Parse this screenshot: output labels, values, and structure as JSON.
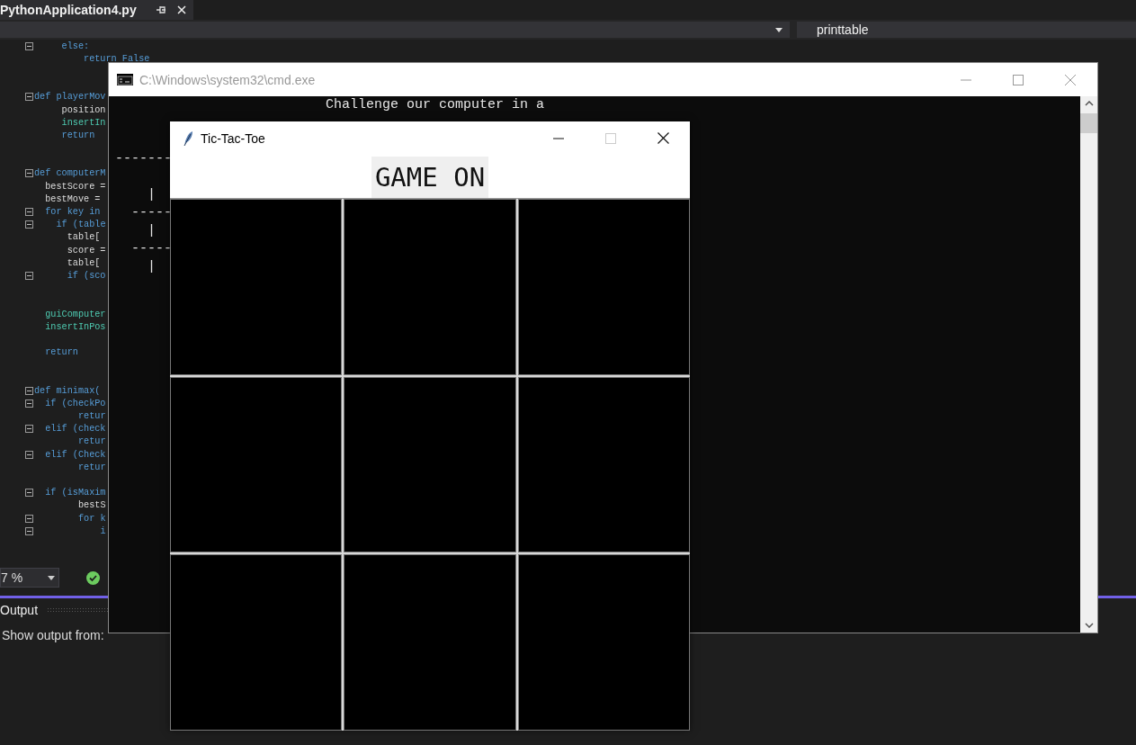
{
  "editor_tab": {
    "title": "PythonApplication4.py"
  },
  "navigation": {
    "member": "printtable"
  },
  "code_lines": [
    {
      "text": "     else:",
      "kind": "keyword",
      "foldable": true
    },
    {
      "text": "         return False",
      "kind": "keyword",
      "foldable": false
    },
    {
      "kind": "blank"
    },
    {
      "kind": "blank"
    },
    {
      "text": "def playerMov",
      "kind": "keyword",
      "foldable": true
    },
    {
      "text": "     position",
      "kind": "plain",
      "foldable": false
    },
    {
      "text": "     insertIn",
      "kind": "call",
      "foldable": false
    },
    {
      "text": "     return",
      "kind": "keyword",
      "foldable": false
    },
    {
      "kind": "blank"
    },
    {
      "kind": "blank"
    },
    {
      "text": "def computerM",
      "kind": "keyword",
      "foldable": true
    },
    {
      "text": "  bestScore =",
      "kind": "plain",
      "foldable": false
    },
    {
      "text": "  bestMove =",
      "kind": "plain",
      "foldable": false
    },
    {
      "text": "  for key in",
      "kind": "keyword",
      "foldable": true
    },
    {
      "text": "    if (table",
      "kind": "keyword",
      "foldable": true
    },
    {
      "text": "      table[",
      "kind": "plain",
      "foldable": false
    },
    {
      "text": "      score =",
      "kind": "plain",
      "foldable": false
    },
    {
      "text": "      table[",
      "kind": "plain",
      "foldable": false
    },
    {
      "text": "      if (sco",
      "kind": "keyword",
      "foldable": true
    },
    {
      "kind": "blank"
    },
    {
      "kind": "blank"
    },
    {
      "text": "  guiComputer",
      "kind": "call",
      "foldable": false
    },
    {
      "text": "  insertInPos",
      "kind": "call",
      "foldable": false
    },
    {
      "kind": "blank"
    },
    {
      "text": "  return",
      "kind": "keyword",
      "foldable": false
    },
    {
      "kind": "blank"
    },
    {
      "kind": "blank"
    },
    {
      "text": "def minimax(",
      "kind": "keyword",
      "foldable": true
    },
    {
      "text": "  if (checkPo",
      "kind": "keyword",
      "foldable": true
    },
    {
      "text": "        retur",
      "kind": "keyword",
      "foldable": false
    },
    {
      "text": "  elif (check",
      "kind": "keyword",
      "foldable": true
    },
    {
      "text": "        retur",
      "kind": "keyword",
      "foldable": false
    },
    {
      "text": "  elif (Check",
      "kind": "keyword",
      "foldable": true
    },
    {
      "text": "        retur",
      "kind": "keyword",
      "foldable": false
    },
    {
      "kind": "blank"
    },
    {
      "text": "  if (isMaxim",
      "kind": "keyword",
      "foldable": true
    },
    {
      "text": "        bestS",
      "kind": "plain",
      "foldable": false
    },
    {
      "text": "        for k",
      "kind": "keyword",
      "foldable": true
    },
    {
      "text": "            i",
      "kind": "keyword",
      "foldable": true
    }
  ],
  "status_bar": {
    "zoom": "7 %"
  },
  "output_panel": {
    "title": "Output",
    "source_label": "Show output from:"
  },
  "console_window": {
    "title": "C:\\Windows\\system32\\cmd.exe",
    "lines": [
      {
        "text": "                          Challenge our computer in a",
        "kind": "text"
      },
      {
        "kind": "blank"
      },
      {
        "kind": "blank"
      },
      {
        "text": "-------",
        "kind": "text"
      },
      {
        "kind": "blank"
      },
      {
        "text": "    |",
        "kind": "text"
      },
      {
        "text": "  -----",
        "kind": "text"
      },
      {
        "text": "    |",
        "kind": "text"
      },
      {
        "text": "  -----",
        "kind": "text"
      },
      {
        "text": "    |",
        "kind": "text"
      }
    ]
  },
  "game_window": {
    "title": "Tic-Tac-Toe",
    "status": "GAME ON",
    "board": [
      {
        "kind": "empty"
      },
      {
        "kind": "empty"
      },
      {
        "kind": "empty"
      },
      {
        "kind": "empty"
      },
      {
        "kind": "empty"
      },
      {
        "kind": "empty"
      },
      {
        "kind": "empty"
      },
      {
        "kind": "empty"
      },
      {
        "kind": "empty"
      }
    ]
  }
}
